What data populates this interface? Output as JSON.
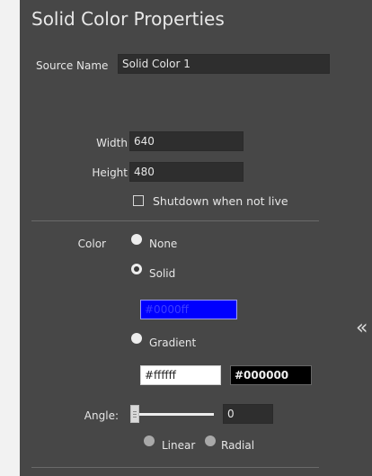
{
  "panel": {
    "title": "Solid Color Properties",
    "source_name_label": "Source Name",
    "source_name_value": "Solid Color 1",
    "width_label": "Width",
    "width_value": "640",
    "height_label": "Height",
    "height_value": "480",
    "shutdown_label": "Shutdown when not live",
    "shutdown_checked": false,
    "color_label": "Color",
    "color_options": {
      "none": "None",
      "solid": "Solid",
      "gradient": "Gradient"
    },
    "selected_color_option": "solid",
    "solid_color_value": "#0000ff",
    "gradient_start_value": "#ffffff",
    "gradient_end_value": "#000000",
    "angle_label": "Angle:",
    "angle_value": "0",
    "gradient_types": {
      "linear": "Linear",
      "radial": "Radial"
    },
    "collapse_icon": "double-chevron-left-icon",
    "colors": {
      "background": "#474747",
      "field": "#2e2e2e",
      "solid_swatch": "#0000ff",
      "gradient_start": "#ffffff",
      "gradient_end": "#000000",
      "text": "#e6e6e6"
    }
  }
}
